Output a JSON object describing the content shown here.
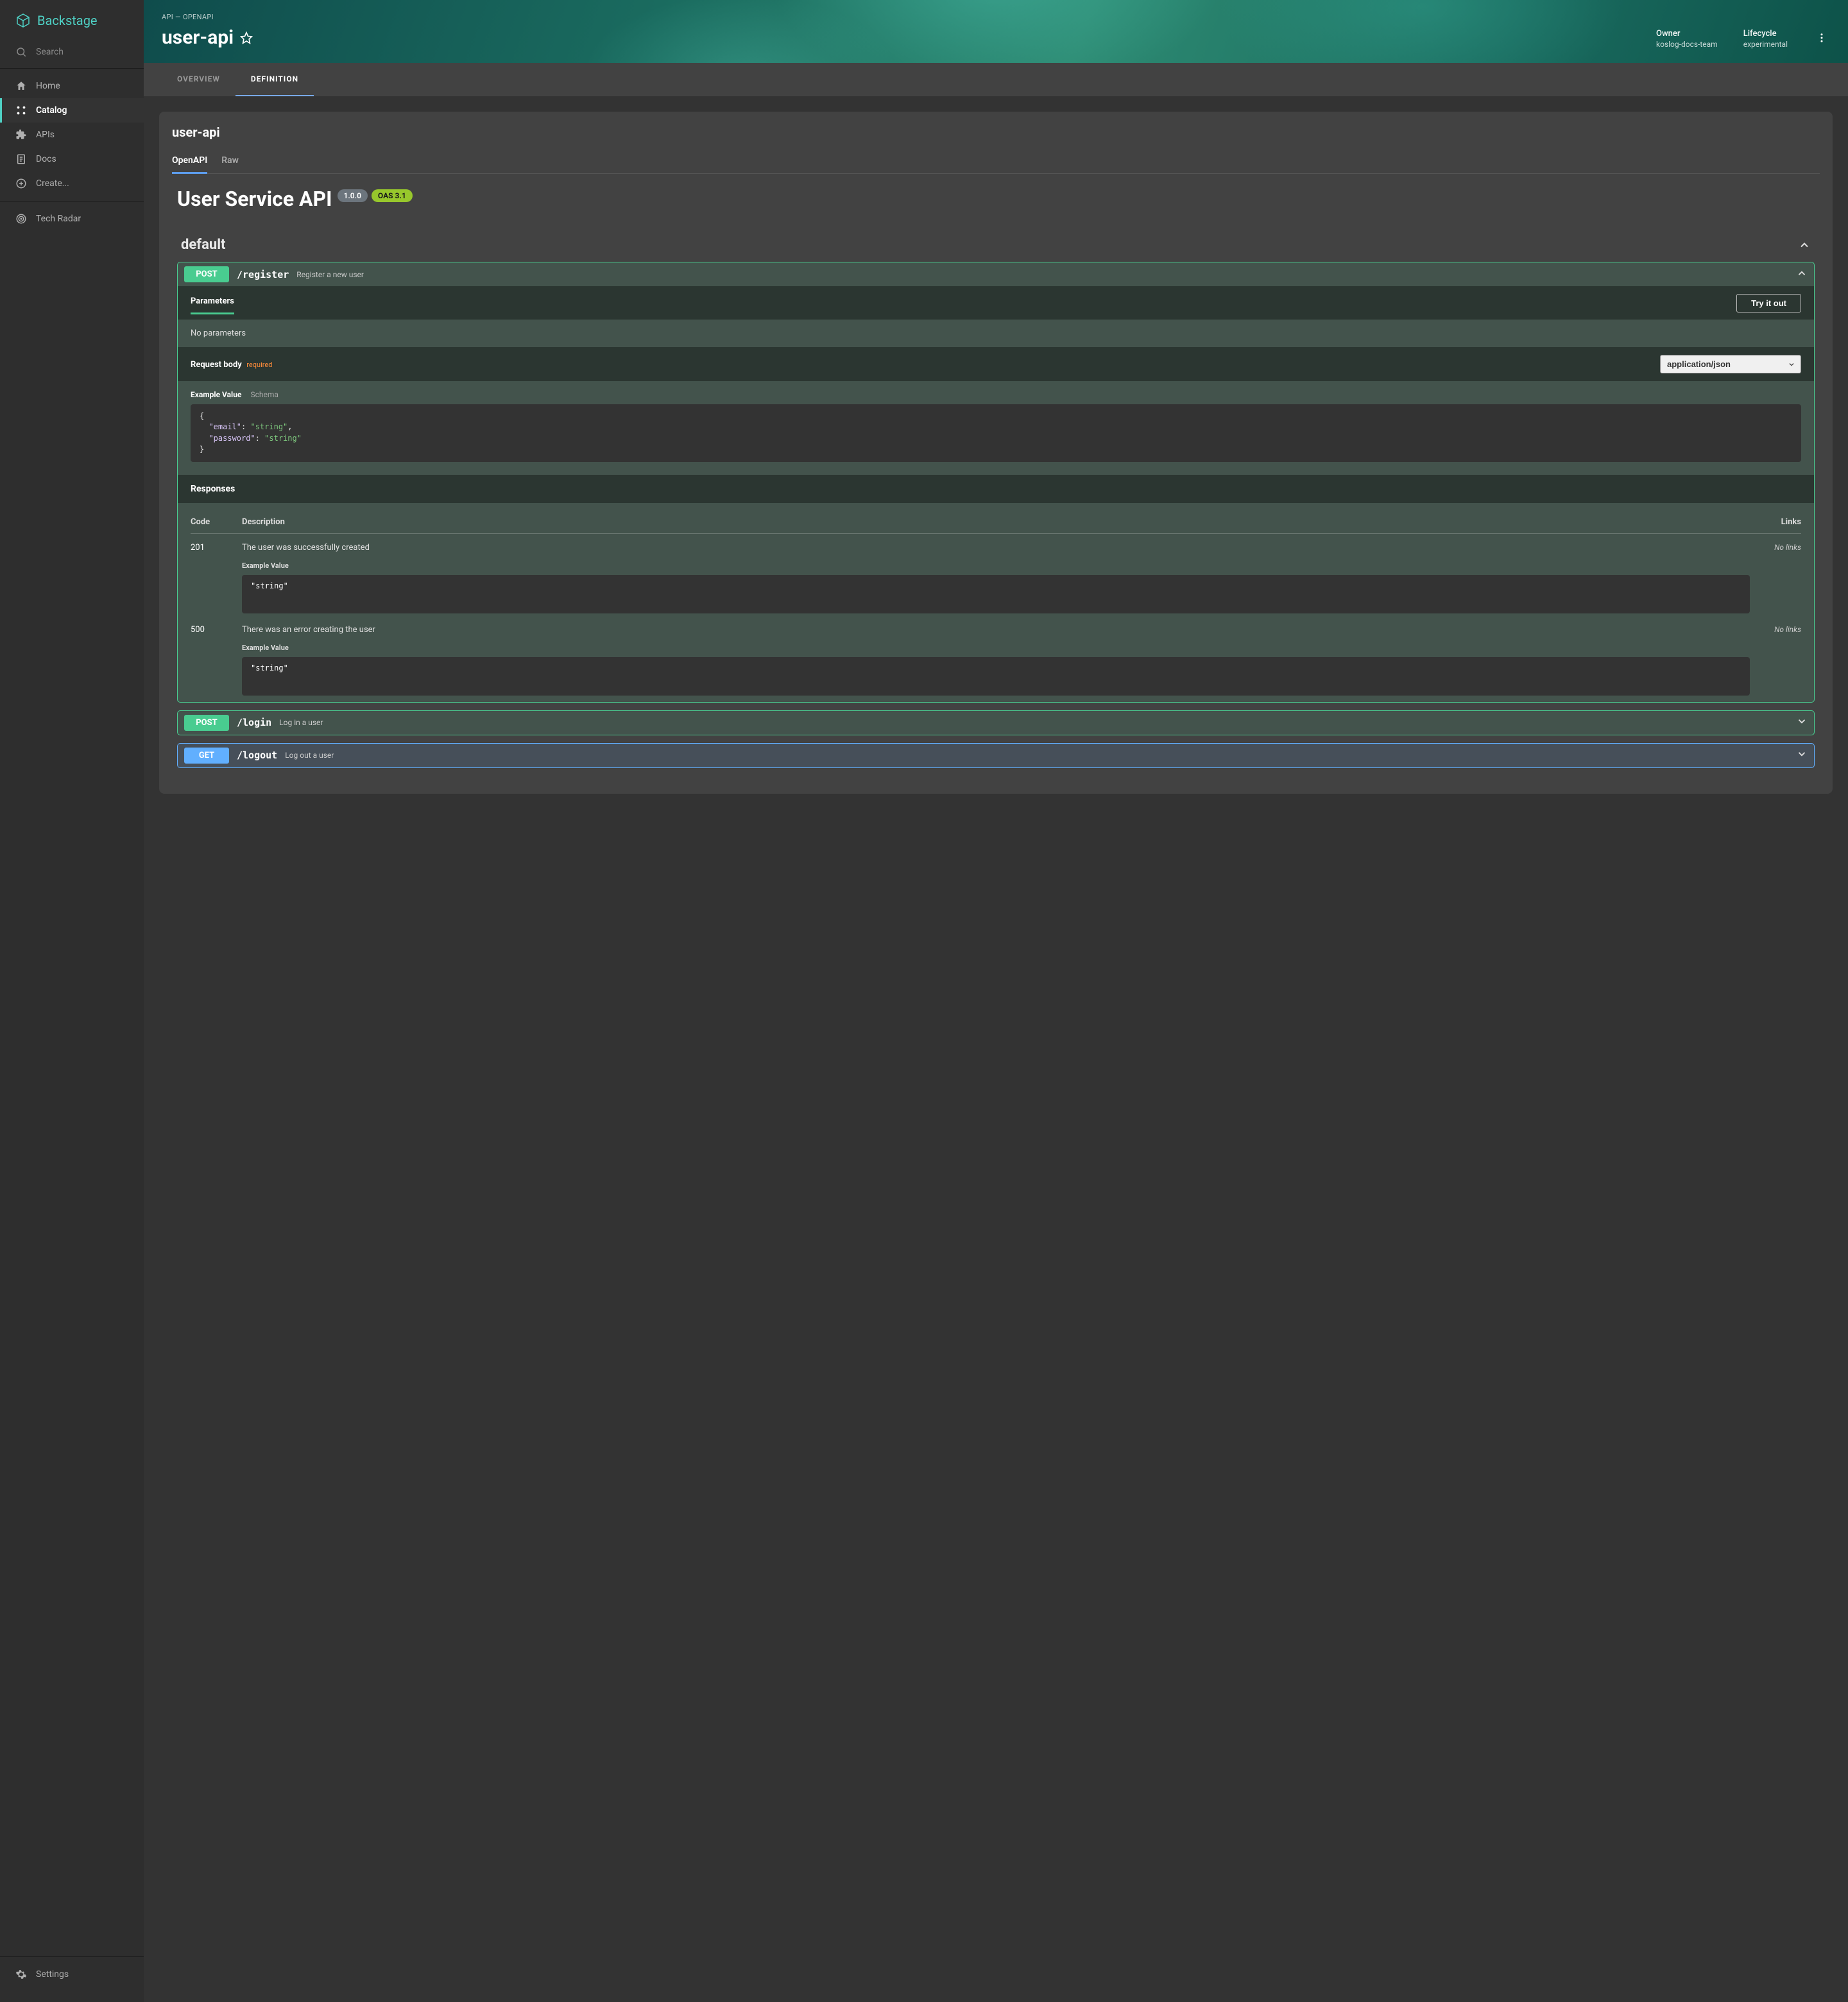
{
  "brand": "Backstage",
  "search": {
    "label": "Search"
  },
  "nav": {
    "home": "Home",
    "catalog": "Catalog",
    "apis": "APIs",
    "docs": "Docs",
    "create": "Create...",
    "techradar": "Tech Radar",
    "settings": "Settings"
  },
  "header": {
    "breadcrumb": "API — OPENAPI",
    "title": "user-api",
    "owner_label": "Owner",
    "owner_value": "koslog-docs-team",
    "lifecycle_label": "Lifecycle",
    "lifecycle_value": "experimental"
  },
  "tabs": {
    "overview": "OVERVIEW",
    "definition": "DEFINITION"
  },
  "card": {
    "title": "user-api",
    "tab_openapi": "OpenAPI",
    "tab_raw": "Raw"
  },
  "api": {
    "title": "User Service API",
    "version": "1.0.0",
    "oas": "OAS 3.1",
    "section": "default",
    "labels": {
      "parameters": "Parameters",
      "try": "Try it out",
      "no_params": "No parameters",
      "request_body": "Request body",
      "required": "required",
      "content_type": "application/json",
      "example_value": "Example Value",
      "schema": "Schema",
      "responses": "Responses",
      "code": "Code",
      "description": "Description",
      "links": "Links",
      "no_links": "No links"
    },
    "ops": [
      {
        "method": "POST",
        "path": "/register",
        "summary": "Register a new user",
        "expanded": true,
        "body_example": "{\n  \"email\": \"string\",\n  \"password\": \"string\"\n}",
        "responses": [
          {
            "code": "201",
            "desc": "The user was successfully created",
            "example": "\"string\""
          },
          {
            "code": "500",
            "desc": "There was an error creating the user",
            "example": "\"string\""
          }
        ]
      },
      {
        "method": "POST",
        "path": "/login",
        "summary": "Log in a user",
        "expanded": false
      },
      {
        "method": "GET",
        "path": "/logout",
        "summary": "Log out a user",
        "expanded": false
      }
    ]
  }
}
